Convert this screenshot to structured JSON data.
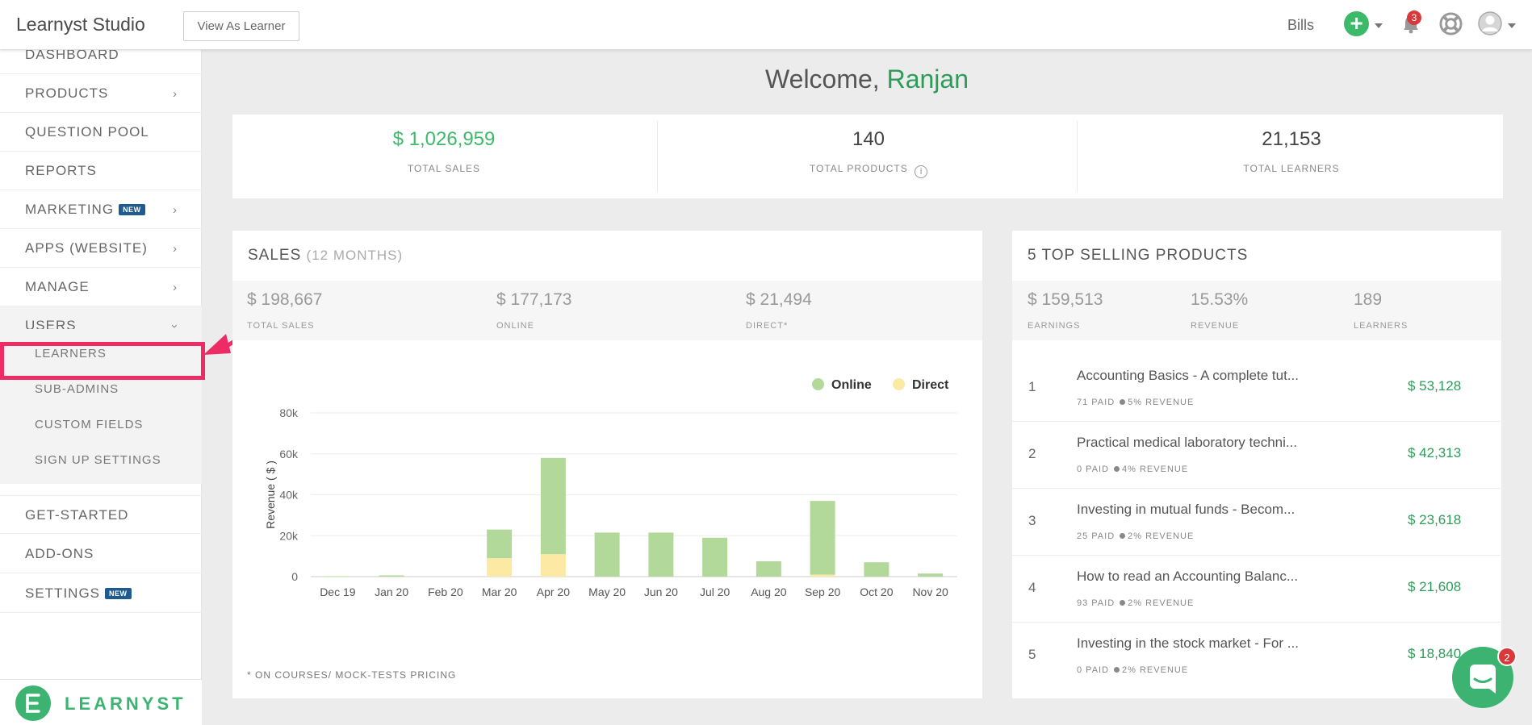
{
  "header": {
    "app_title": "Learnyst Studio",
    "view_as_learner": "View As Learner",
    "bills": "Bills",
    "notification_count": "3"
  },
  "sidebar": {
    "items": [
      {
        "label": "DASHBOARD"
      },
      {
        "label": "PRODUCTS"
      },
      {
        "label": "QUESTION POOL"
      },
      {
        "label": "REPORTS"
      },
      {
        "label": "MARKETING",
        "badge": "NEW"
      },
      {
        "label": "APPS (WEBSITE)"
      },
      {
        "label": "MANAGE"
      },
      {
        "label": "USERS"
      }
    ],
    "users_submenu": [
      "LEARNERS",
      "SUB-ADMINS",
      "CUSTOM FIELDS",
      "SIGN UP SETTINGS"
    ],
    "bottom_items": [
      {
        "label": "GET-STARTED"
      },
      {
        "label": "ADD-ONS"
      },
      {
        "label": "SETTINGS",
        "badge": "NEW"
      }
    ],
    "logo_text": "LEARNYST"
  },
  "welcome": {
    "prefix": "Welcome,",
    "name": "Ranjan"
  },
  "stats": [
    {
      "value": "$ 1,026,959",
      "label": "TOTAL SALES"
    },
    {
      "value": "140",
      "label": "TOTAL PRODUCTS"
    },
    {
      "value": "21,153",
      "label": "TOTAL LEARNERS"
    }
  ],
  "sales_card": {
    "title": "SALES",
    "subtitle": "(12 MONTHS)",
    "summary": [
      {
        "value": "$ 198,667",
        "label": "TOTAL SALES"
      },
      {
        "value": "$ 177,173",
        "label": "ONLINE"
      },
      {
        "value": "$ 21,494",
        "label": "DIRECT*"
      }
    ],
    "footnote": "* ON COURSES/ MOCK-TESTS PRICING"
  },
  "chart_data": {
    "type": "bar",
    "stacked": true,
    "categories": [
      "Dec 19",
      "Jan 20",
      "Feb 20",
      "Mar 20",
      "Apr 20",
      "May 20",
      "Jun 20",
      "Jul 20",
      "Aug 20",
      "Sep 20",
      "Oct 20",
      "Nov 20"
    ],
    "series": [
      {
        "name": "Direct",
        "color": "#fbe9a4",
        "values": [
          0,
          0,
          0,
          9000,
          11000,
          0,
          0,
          0,
          0,
          1000,
          0,
          0
        ]
      },
      {
        "name": "Online",
        "color": "#b3d99a",
        "values": [
          200,
          600,
          0,
          14000,
          47000,
          21500,
          21500,
          19000,
          7500,
          36000,
          7000,
          1500
        ]
      }
    ],
    "ylabel": "Revenue ( $ )",
    "yticks": [
      "0",
      "20k",
      "40k",
      "60k",
      "80k"
    ],
    "ylim": [
      0,
      80000
    ],
    "grid": true,
    "legend": "top-right"
  },
  "top_products": {
    "title": "5 TOP SELLING PRODUCTS",
    "summary": [
      {
        "value": "$ 159,513",
        "label": "EARNINGS"
      },
      {
        "value": "15.53%",
        "label": "REVENUE"
      },
      {
        "value": "189",
        "label": "LEARNERS"
      }
    ],
    "items": [
      {
        "rank": "1",
        "name": "Accounting Basics - A complete tut...",
        "paid": "71 PAID",
        "revenue": "5% REVENUE",
        "amount": "$ 53,128"
      },
      {
        "rank": "2",
        "name": "Practical medical laboratory techni...",
        "paid": "0 PAID",
        "revenue": "4% REVENUE",
        "amount": "$ 42,313"
      },
      {
        "rank": "3",
        "name": "Investing in mutual funds - Becom...",
        "paid": "25 PAID",
        "revenue": "2% REVENUE",
        "amount": "$ 23,618"
      },
      {
        "rank": "4",
        "name": "How to read an Accounting Balanc...",
        "paid": "93 PAID",
        "revenue": "2% REVENUE",
        "amount": "$ 21,608"
      },
      {
        "rank": "5",
        "name": "Investing in the stock market - For ...",
        "paid": "0 PAID",
        "revenue": "2% REVENUE",
        "amount": "$ 18,840"
      }
    ]
  },
  "chat_badge": "2",
  "colors": {
    "accent_green": "#3cb371",
    "highlight_pink": "#ef2b65",
    "badge_blue": "#1f5b8f"
  }
}
